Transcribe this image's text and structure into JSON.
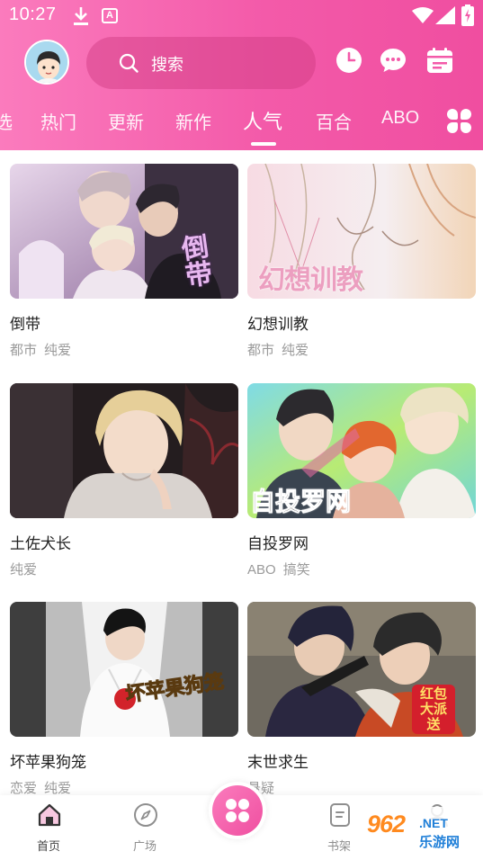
{
  "status_bar": {
    "time": "10:27",
    "notification_badge": "A"
  },
  "header": {
    "search_placeholder": "搜索",
    "tabs": [
      "选",
      "热门",
      "更新",
      "新作",
      "人气",
      "百合",
      "ABO"
    ],
    "active_tab": "人气"
  },
  "comics": [
    {
      "title": "倒带",
      "tags": [
        "都市",
        "纯爱"
      ],
      "cover_text": "倒带"
    },
    {
      "title": "幻想训教",
      "tags": [
        "都市",
        "纯爱"
      ],
      "cover_text": "幻想训教"
    },
    {
      "title": "土佐犬长",
      "tags": [
        "纯爱"
      ],
      "cover_text": ""
    },
    {
      "title": "自投罗网",
      "tags": [
        "ABO",
        "搞笑"
      ],
      "cover_text": "自投罗网"
    },
    {
      "title": "坏苹果狗笼",
      "tags": [
        "恋爱",
        "纯爱"
      ],
      "cover_text": "坏苹果狗笼"
    },
    {
      "title": "末世求生",
      "tags": [
        "悬疑"
      ],
      "cover_text": "红包大派送"
    }
  ],
  "bottom_nav": {
    "home": "首页",
    "square": "广场",
    "shelf": "书架"
  },
  "watermark": {
    "main": "962",
    "net": ".NET",
    "sub": "乐游网"
  },
  "colors": {
    "header_pink": "#f35aa9",
    "accent_pink": "#fb7cbd"
  }
}
